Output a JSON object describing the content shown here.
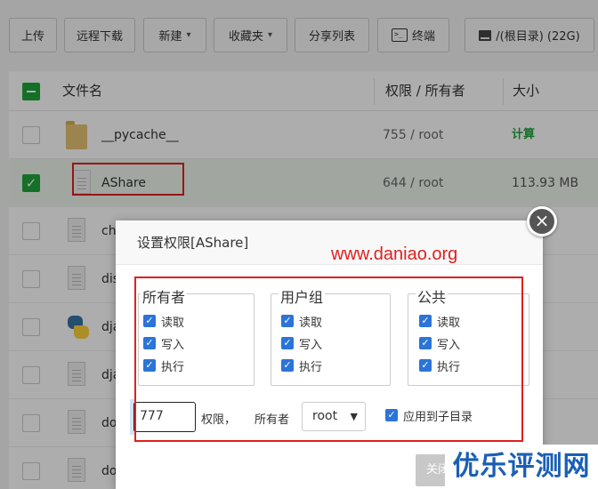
{
  "toolbar": {
    "upload": "上传",
    "remote_download": "远程下载",
    "new": "新建",
    "favorites": "收藏夹",
    "share_list": "分享列表",
    "terminal": "终端",
    "disk": "/(根目录) (22G)"
  },
  "table": {
    "headers": {
      "name": "文件名",
      "perm_owner": "权限 / 所有者",
      "size": "大小"
    },
    "rows": [
      {
        "name": "__pycache__",
        "type": "folder",
        "perm": "755 / root",
        "size": "计算",
        "checked": false
      },
      {
        "name": "AShare",
        "type": "file",
        "perm": "644 / root",
        "size": "113.93 MB",
        "checked": true
      },
      {
        "name": "ch",
        "type": "file",
        "checked": false
      },
      {
        "name": "dis",
        "type": "file",
        "checked": false
      },
      {
        "name": "dja",
        "type": "python",
        "checked": false
      },
      {
        "name": "dja",
        "type": "file",
        "checked": false
      },
      {
        "name": "do",
        "type": "file",
        "checked": false
      },
      {
        "name": "do",
        "type": "file",
        "checked": false
      }
    ]
  },
  "dialog": {
    "title": "设置权限[AShare]",
    "groups": [
      {
        "legend": "所有者",
        "read": "读取",
        "write": "写入",
        "exec": "执行"
      },
      {
        "legend": "用户组",
        "read": "读取",
        "write": "写入",
        "exec": "执行"
      },
      {
        "legend": "公共",
        "read": "读取",
        "write": "写入",
        "exec": "执行"
      }
    ],
    "perm_value": "777",
    "perm_label": "权限，",
    "owner_label": "所有者",
    "owner_value": "root",
    "apply_sub": "应用到子目录",
    "close_btn": "关闭",
    "close_icon": "×"
  },
  "watermarks": {
    "url": "www.daniao.org",
    "brand": "优乐评测网"
  },
  "colors": {
    "accent_green": "#20a53a",
    "checkbox_blue": "#2b74d8",
    "annotation_red": "#e02020",
    "brand_blue": "#1a5fb4"
  }
}
